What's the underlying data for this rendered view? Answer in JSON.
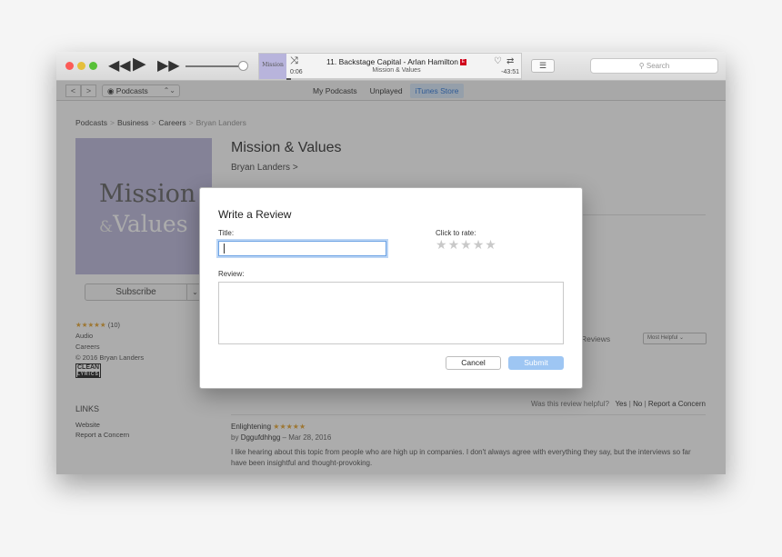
{
  "player": {
    "rewind_icon": "rewind-icon",
    "play_icon": "play-icon",
    "forward_icon": "fast-forward-icon",
    "volume_level": 0.9,
    "now_playing": {
      "artwork_text": "Mission",
      "title": "11. Backstage Capital - Arlan Hamilton",
      "explicit_badge": "E",
      "subtitle": "Mission & Values",
      "elapsed": "0:06",
      "remaining": "-43:51",
      "progress": 0.01
    },
    "list_icon": "list-icon",
    "search_placeholder": "Search"
  },
  "navbar": {
    "back": "<",
    "forward": ">",
    "media_kind": "Podcasts",
    "tabs": [
      {
        "label": "My Podcasts",
        "active": false
      },
      {
        "label": "Unplayed",
        "active": false
      },
      {
        "label": "iTunes Store",
        "active": true
      }
    ]
  },
  "breadcrumb": {
    "items": [
      "Podcasts",
      "Business",
      "Careers"
    ],
    "current": "Bryan Landers",
    "separator": ">"
  },
  "podcast": {
    "cover_line1": "Mission",
    "cover_amp": "&",
    "cover_line2": "Values",
    "title": "Mission & Values",
    "author": "Bryan Landers >",
    "subscribe_label": "Subscribe",
    "rating_stars": "★★★★★",
    "rating_count": "(10)",
    "type": "Audio",
    "category": "Careers",
    "copyright": "© 2016 Bryan Landers",
    "clean_label": "CLEAN",
    "lyrics_label": "LYRICS"
  },
  "links": {
    "heading": "LINKS",
    "website": "Website",
    "report": "Report a Concern"
  },
  "reviews": {
    "heading": "mer Reviews",
    "sort_label": "Most Helpful",
    "helpful_prompt": "Was this review helpful?",
    "yes": "Yes",
    "no": "No",
    "report": "Report a Concern",
    "pipe": "|",
    "first": {
      "title": "Enlightening",
      "stars": "★★★★★",
      "by": "by",
      "author": "Dggufdhhgg",
      "date": "– Mar 28, 2016",
      "body": "I like hearing about this topic from people who are high up in companies. I don't always agree with everything they say, but the interviews so far have been insightful and thought-provoking."
    }
  },
  "dialog": {
    "title": "Write a Review",
    "title_label": "Title:",
    "title_value": "",
    "rate_label": "Click to rate:",
    "rating": 0,
    "review_label": "Review:",
    "review_value": "",
    "cancel_label": "Cancel",
    "submit_label": "Submit"
  },
  "colors": {
    "accent": "#1a6bd6",
    "star": "#e39d1f",
    "submit_disabled": "#9ec6f3"
  }
}
